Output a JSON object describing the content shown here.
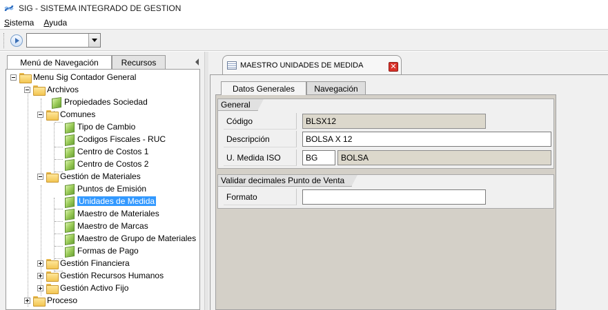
{
  "window": {
    "title": "SIG - SISTEMA INTEGRADO DE GESTION"
  },
  "menu": {
    "items": [
      {
        "first": "S",
        "rest": "istema"
      },
      {
        "first": "A",
        "rest": "yuda"
      }
    ]
  },
  "toolbar": {
    "combo_value": ""
  },
  "nav": {
    "tab_active": "Menú de Navegación",
    "tab_inactive": "Recursos",
    "tree": [
      {
        "label": "Menu Sig  Contador General"
      },
      {
        "label": "Archivos"
      },
      {
        "label": "Propiedades Sociedad"
      },
      {
        "label": "Comunes"
      },
      {
        "label": "Tipo de Cambio"
      },
      {
        "label": "Codigos Fiscales - RUC"
      },
      {
        "label": "Centro de Costos 1"
      },
      {
        "label": "Centro de Costos 2"
      },
      {
        "label": "Gestión de Materiales"
      },
      {
        "label": "Puntos de Emisión"
      },
      {
        "label": "Unidades de Medida"
      },
      {
        "label": "Maestro de Materiales"
      },
      {
        "label": "Maestro de Marcas"
      },
      {
        "label": "Maestro de Grupo de Materiales"
      },
      {
        "label": "Formas de Pago"
      },
      {
        "label": "Gestión Financiera"
      },
      {
        "label": "Gestión Recursos Humanos"
      },
      {
        "label": "Gestión Activo Fijo"
      },
      {
        "label": "Proceso"
      }
    ]
  },
  "document": {
    "tab_title": "MAESTRO UNIDADES DE MEDIDA",
    "close_glyph": "✕",
    "subtabs": [
      "Datos Generales",
      "Navegación"
    ],
    "general": {
      "title": "General",
      "codigo_label": "Código",
      "codigo_value": "BLSX12",
      "descripcion_label": "Descripción",
      "descripcion_value": "BOLSA X 12",
      "umedida_label": "U. Medida ISO",
      "umedida_code": "BG",
      "umedida_name": "BOLSA"
    },
    "validar": {
      "title": "Validar decimales Punto de Venta",
      "formato_label": "Formato",
      "formato_value": ""
    }
  }
}
